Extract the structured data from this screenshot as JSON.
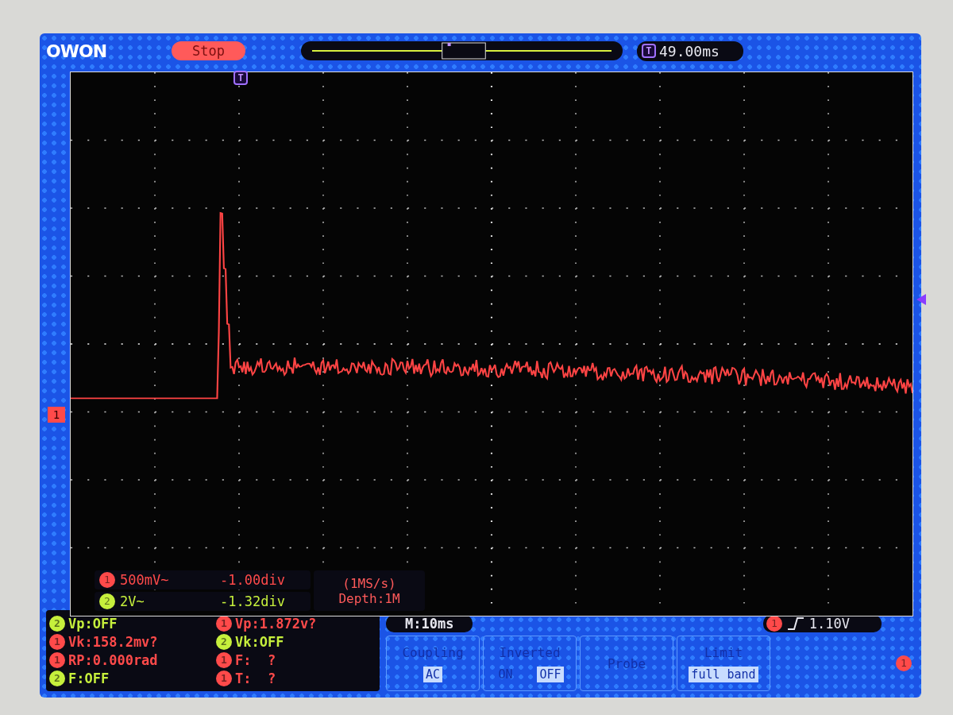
{
  "header": {
    "logo": "OWON",
    "run_state": "Stop",
    "time_marker": "T",
    "trigger_time": "49.00ms"
  },
  "display": {
    "channel_marker": "1",
    "position_marker": "T"
  },
  "channels": [
    {
      "badge": "1",
      "color": "#ff4a4a",
      "scale": "500mV~",
      "offset": "-1.00div"
    },
    {
      "badge": "2",
      "color": "#c6ef3c",
      "scale": "2V~",
      "offset": "-1.32div"
    }
  ],
  "acquisition": {
    "sample_rate": "(1MS/s)",
    "depth": "Depth:1M"
  },
  "measurements": [
    {
      "badge": "2",
      "color": "#c6ef3c",
      "text": "Vp:OFF"
    },
    {
      "badge": "1",
      "color": "#ff4a4a",
      "text": "Vp:1.872v?"
    },
    {
      "badge": "1",
      "color": "#ff4a4a",
      "text": "Vk:158.2mv?"
    },
    {
      "badge": "2",
      "color": "#c6ef3c",
      "text": "Vk:OFF"
    },
    {
      "badge": "1",
      "color": "#ff4a4a",
      "text": "RP:0.000rad"
    },
    {
      "badge": "1",
      "color": "#ff4a4a",
      "text": "F:  ?"
    },
    {
      "badge": "2",
      "color": "#c6ef3c",
      "text": "F:OFF"
    },
    {
      "badge": "1",
      "color": "#ff4a4a",
      "text": "T:  ?"
    }
  ],
  "timebase": "M:10ms",
  "trigger": {
    "badge": "1",
    "value": "1.10V"
  },
  "menu": [
    {
      "title": "Coupling",
      "options": [
        {
          "label": "AC",
          "selected": true
        }
      ]
    },
    {
      "title": "Inverted",
      "options": [
        {
          "label": "ON",
          "selected": false
        },
        {
          "label": "OFF",
          "selected": true
        }
      ]
    },
    {
      "title": "Probe"
    },
    {
      "title": "Limit",
      "options": [
        {
          "label": "full band",
          "selected": true
        }
      ]
    }
  ],
  "side_badge": "1"
}
